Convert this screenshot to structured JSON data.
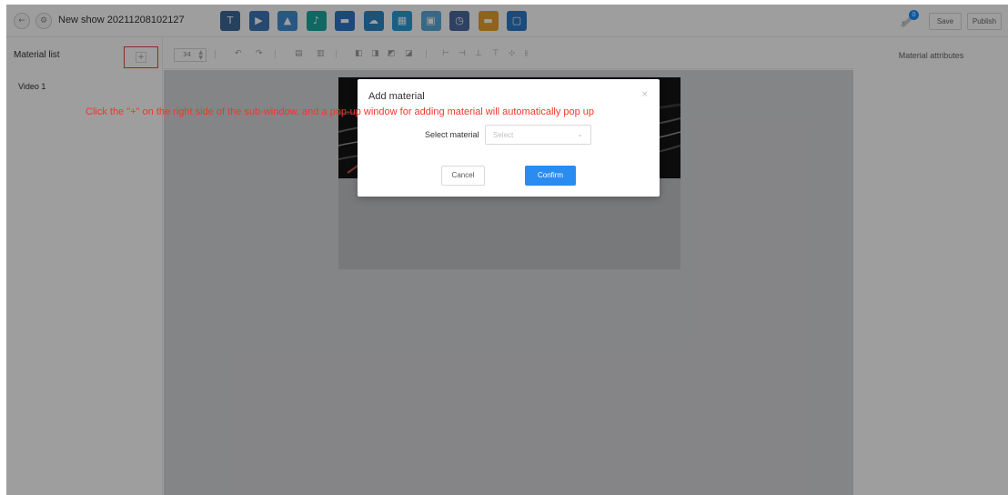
{
  "header": {
    "back_icon": "arrow-left-icon",
    "settings_icon": "gear-icon",
    "show_title": "New show 20211208102127",
    "tools": [
      {
        "name": "text-tool",
        "icon": "text-icon",
        "color": "#3d6a9a",
        "glyph": "T"
      },
      {
        "name": "video-tool",
        "icon": "video-icon",
        "color": "#3e76b6",
        "glyph": "▶"
      },
      {
        "name": "image-tool",
        "icon": "image-icon",
        "color": "#3f8fd6",
        "glyph": "▲"
      },
      {
        "name": "audio-tool",
        "icon": "music-icon",
        "color": "#1ba9a0",
        "glyph": "♪"
      },
      {
        "name": "folder-tool",
        "icon": "folder-icon",
        "color": "#2f74c8",
        "glyph": "▬"
      },
      {
        "name": "weather-tool",
        "icon": "cloud-icon",
        "color": "#2e86c4",
        "glyph": "☁"
      },
      {
        "name": "calendar-tool",
        "icon": "calendar-icon",
        "color": "#2a9ad6",
        "glyph": "▦"
      },
      {
        "name": "slide-tool",
        "icon": "slideshow-icon",
        "color": "#5da9d8",
        "glyph": "▣"
      },
      {
        "name": "clock-tool",
        "icon": "clock-icon",
        "color": "#4b6aa0",
        "glyph": "◷"
      },
      {
        "name": "web-tool",
        "icon": "web-icon",
        "color": "#e8a12a",
        "glyph": "▬"
      },
      {
        "name": "window-tool",
        "icon": "window-icon",
        "color": "#2c7ac9",
        "glyph": "▢"
      }
    ],
    "notification_icon": "rocket-icon",
    "notification_count": "0",
    "save_label": "Save",
    "publish_label": "Publish"
  },
  "left_panel": {
    "title": "Material list",
    "add_label": "+",
    "items": [
      "Video 1"
    ]
  },
  "toolbar": {
    "font_size": "34"
  },
  "right_panel": {
    "title": "Material attributes"
  },
  "modal": {
    "title": "Add material",
    "close_label": "×",
    "field_label": "Select material",
    "select_placeholder": "Select",
    "cancel_label": "Cancel",
    "confirm_label": "Confirm"
  },
  "annotation": "Click the \"+\" on the right side of the sub-window, and a pop-up window for adding material will automatically pop up",
  "colors": {
    "accent": "#2a8cf0",
    "annotation": "#f2362a",
    "highlight_box": "#e8453c"
  }
}
